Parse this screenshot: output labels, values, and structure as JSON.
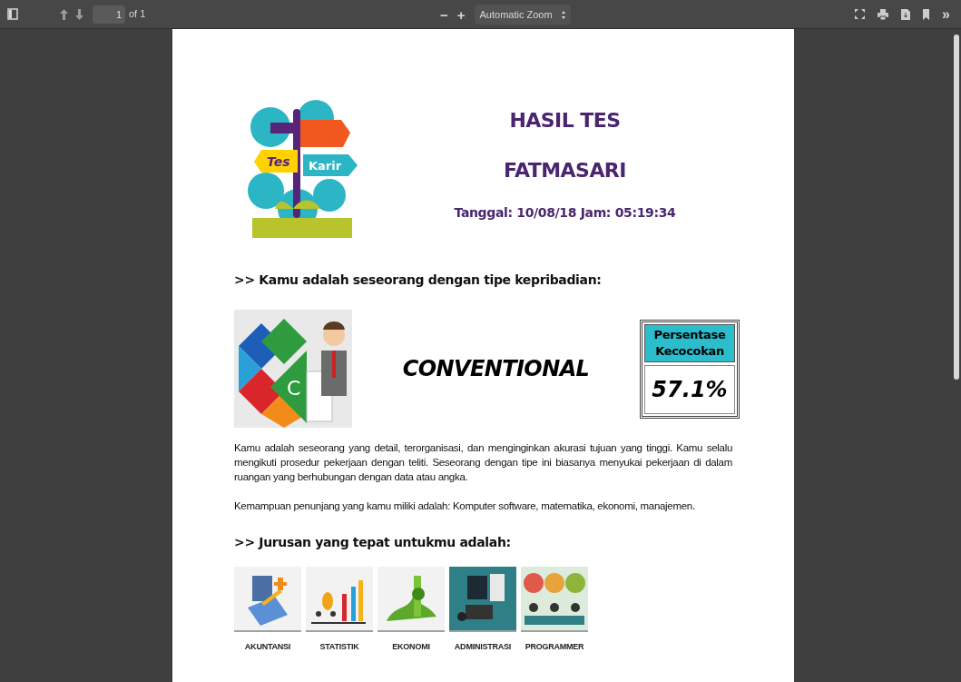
{
  "toolbar": {
    "page_input": "1",
    "page_count": "of 1",
    "zoom_out": "−",
    "zoom_in": "+",
    "zoom_select": "Automatic Zoom",
    "more": "»"
  },
  "document": {
    "logo_texts": [
      "Tes",
      "Karir"
    ],
    "title": "HASIL TES",
    "name": "FATMASARI",
    "date_line": "Tanggal: 10/08/18 Jam: 05:19:34",
    "personality_heading": ">> Kamu adalah seseorang dengan tipe kepribadian:",
    "personality": {
      "badge_letter": "C",
      "type": "CONVENTIONAL",
      "match_label": "Persentase Kecocokan",
      "match_value": "57.1%"
    },
    "paragraphs": [
      "Kamu adalah seseorang yang detail, terorganisasi, dan menginginkan akurasi tujuan yang tinggi. Kamu selalu mengikuti prosedur pekerjaan dengan teliti. Seseorang dengan tipe ini biasanya menyukai pekerjaan di dalam ruangan yang berhubungan dengan data atau angka.",
      "Kemampuan penunjang yang kamu miliki adalah: Komputer software, matematika, ekonomi, manajemen."
    ],
    "majors_heading": ">> Jurusan yang tepat untukmu adalah:",
    "majors": [
      {
        "label": "AKUNTANSI",
        "kind": "accounting"
      },
      {
        "label": "STATISTIK",
        "kind": "statistics"
      },
      {
        "label": "EKONOMI",
        "kind": "economy"
      },
      {
        "label": "ADMINISTRASI",
        "kind": "administration"
      },
      {
        "label": "PROGRAMMER",
        "kind": "programming"
      }
    ]
  }
}
